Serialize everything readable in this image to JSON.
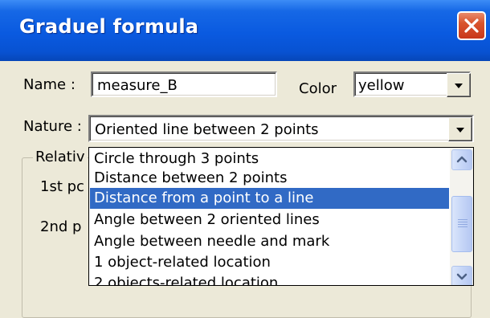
{
  "window": {
    "title": "Graduel formula"
  },
  "icons": {
    "close": "close-x-icon",
    "dropdown": "chevron-down-icon",
    "scroll_up": "scroll-up-icon",
    "scroll_down": "scroll-down-icon"
  },
  "form": {
    "name_label": "Name :",
    "name_value": "measure_B",
    "color_label": "Color",
    "color_value": "yellow",
    "nature_label": "Nature :",
    "nature_value": "Oriented line between 2 points"
  },
  "group": {
    "label": "Relativ",
    "first_point_label": "1st pc",
    "second_point_label": "2nd p"
  },
  "nature_list": {
    "selected_index": 2,
    "items": [
      "Circle through 3 points",
      "Distance between 2 points",
      "Distance from a point to a line",
      "Angle between 2 oriented lines",
      "Angle between needle and mark",
      "1 object-related location",
      "2 objects-related location"
    ]
  },
  "colors": {
    "titlebar": "#0a5ae0",
    "selection": "#316ac5",
    "dialog_bg": "#ece9d8",
    "close_button": "#d9542d"
  }
}
